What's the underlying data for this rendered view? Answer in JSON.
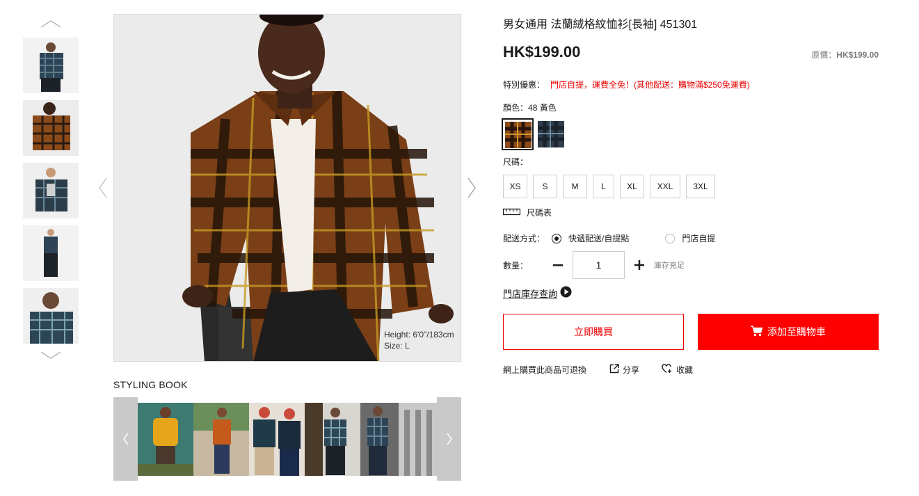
{
  "product": {
    "title": "男女通用 法蘭絨格紋恤衫[長袖] 451301",
    "price": "HK$199.00",
    "original_price_label": "原價：",
    "original_price": "HK$199.00"
  },
  "promo": {
    "label": "特別優惠：",
    "text": "門店自提，運費全免！(其他配送：購物滿$250免運費)"
  },
  "color": {
    "label": "顏色：",
    "selected": "48 黃色",
    "swatches": [
      {
        "name": "yellow-plaid",
        "color": "#8a4a1a"
      },
      {
        "name": "navy-plaid",
        "color": "#2f3c4a"
      }
    ]
  },
  "size": {
    "label": "尺碼：",
    "options": [
      "XS",
      "S",
      "M",
      "L",
      "XL",
      "XXL",
      "3XL"
    ],
    "chart_label": "尺碼表"
  },
  "delivery": {
    "label": "配送方式：",
    "options": [
      "快遞配送/自提點",
      "門店自提"
    ],
    "selected": "快遞配送/自提點"
  },
  "quantity": {
    "label": "數量：",
    "value": "1",
    "stock": "庫存充足"
  },
  "store_inventory": "門店庫存查詢",
  "buttons": {
    "buy_now": "立即購買",
    "add_to_cart": "添加至購物車"
  },
  "footer_row": {
    "returns": "網上購買此商品可退換",
    "share": "分享",
    "favorite": "收藏"
  },
  "gallery": {
    "caption_line1": "Height: 6'0\"/183cm",
    "caption_line2": "Size: L"
  },
  "styling_book": {
    "title": "STYLING BOOK"
  },
  "colors": {
    "accent_red": "#ff0000",
    "promo_red": "#ee0000"
  }
}
